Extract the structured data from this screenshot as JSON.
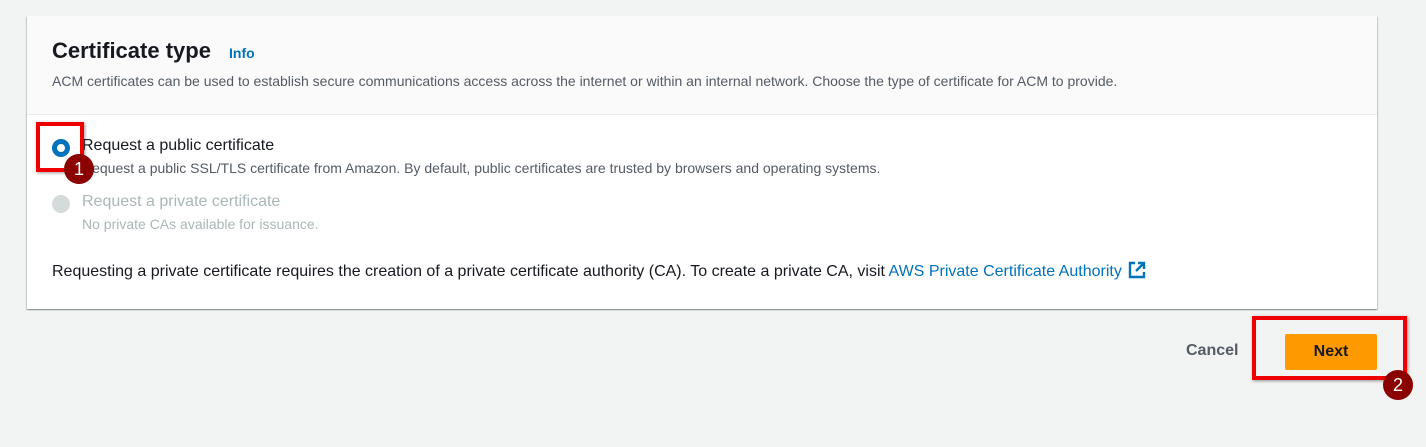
{
  "card": {
    "title": "Certificate type",
    "info_link": "Info",
    "description": "ACM certificates can be used to establish secure communications access across the internet or within an internal network. Choose the type of certificate for ACM to provide.",
    "options": [
      {
        "label": "Request a public certificate",
        "sub": "Request a public SSL/TLS certificate from Amazon. By default, public certificates are trusted by browsers and operating systems.",
        "selected": true,
        "disabled": false
      },
      {
        "label": "Request a private certificate",
        "sub": "No private CAs available for issuance.",
        "selected": false,
        "disabled": true
      }
    ],
    "note_text": "Requesting a private certificate requires the creation of a private certificate authority (CA). To create a private CA, visit ",
    "note_link": "AWS Private Certificate Authority"
  },
  "actions": {
    "cancel": "Cancel",
    "next": "Next"
  },
  "annotations": {
    "step1": "1",
    "step2": "2"
  },
  "colors": {
    "accent": "#0073bb",
    "primary_button": "#ff9900",
    "highlight": "#ee0000"
  }
}
